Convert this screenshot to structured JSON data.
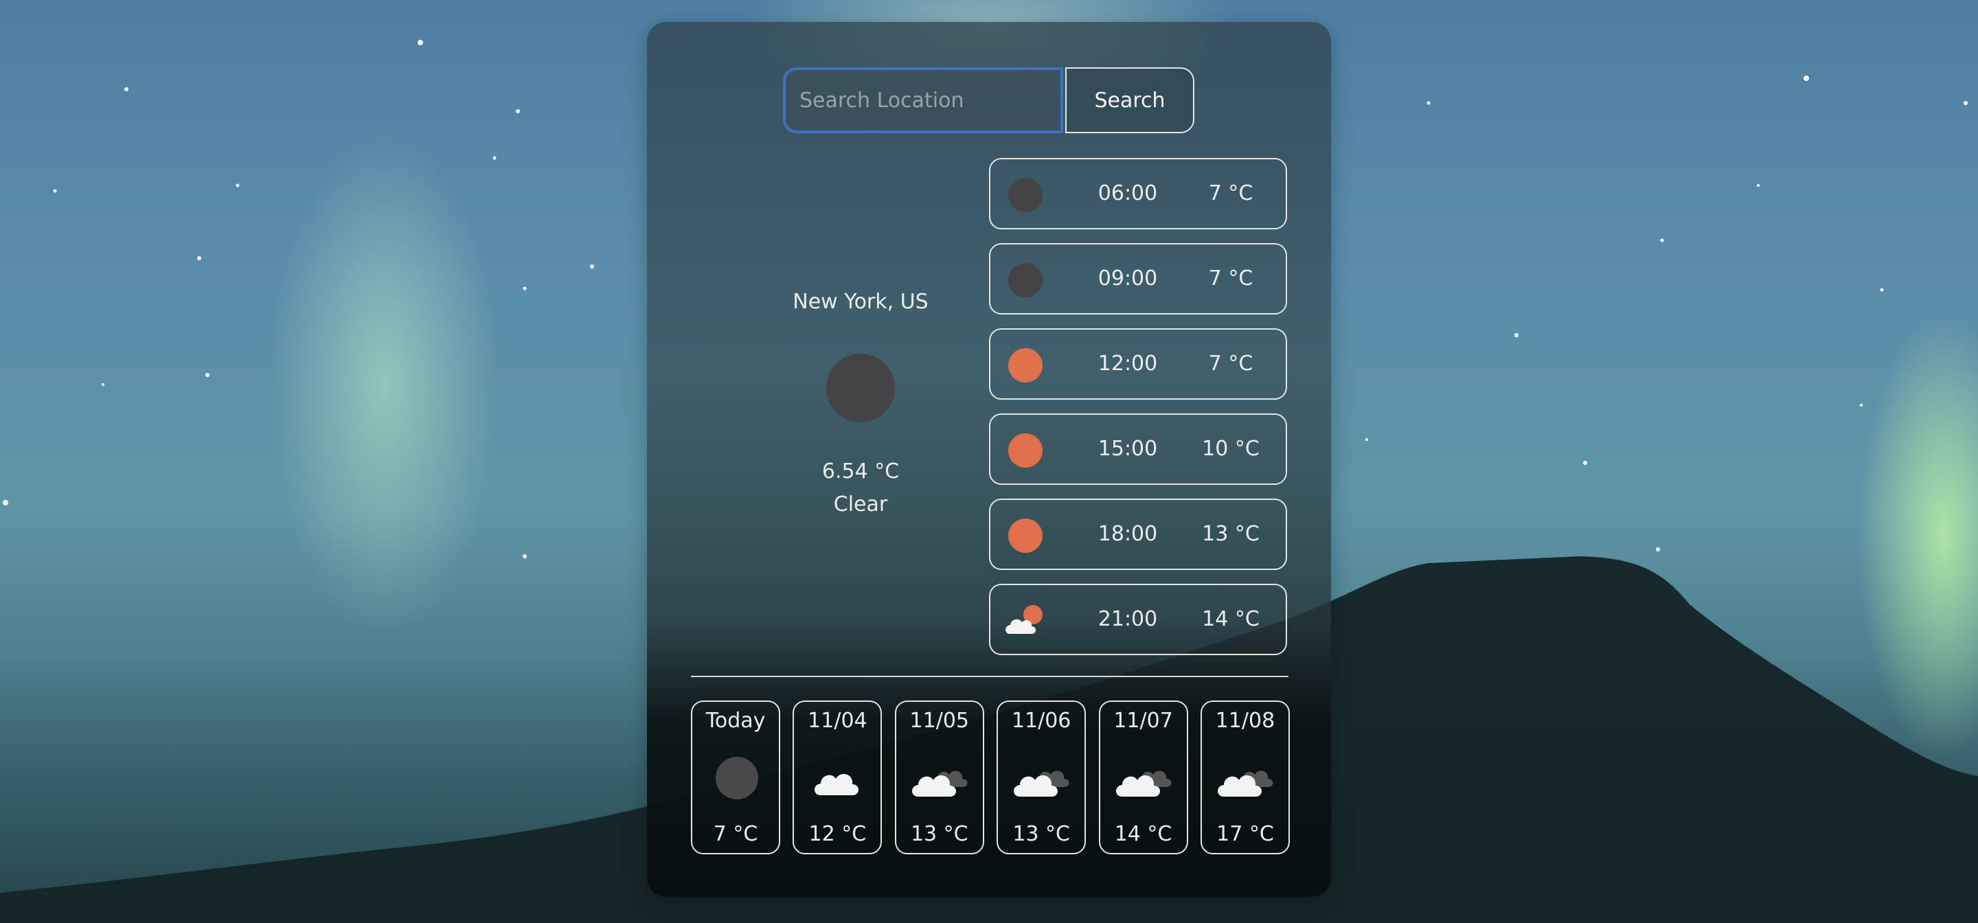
{
  "search": {
    "placeholder": "Search Location",
    "value": "",
    "button_label": "Search"
  },
  "current": {
    "location": "New York, US",
    "icon": "night-clear-icon",
    "temperature": "6.54 °C",
    "description": "Clear"
  },
  "hourly": [
    {
      "time": "06:00",
      "temp": "7 °C",
      "icon": "night-clear-icon"
    },
    {
      "time": "09:00",
      "temp": "7 °C",
      "icon": "night-clear-icon"
    },
    {
      "time": "12:00",
      "temp": "7 °C",
      "icon": "sun-icon"
    },
    {
      "time": "15:00",
      "temp": "10 °C",
      "icon": "sun-icon"
    },
    {
      "time": "18:00",
      "temp": "13 °C",
      "icon": "sun-icon"
    },
    {
      "time": "21:00",
      "temp": "14 °C",
      "icon": "partly-cloudy-icon"
    }
  ],
  "daily": [
    {
      "label": "Today",
      "temp": "7 °C",
      "icon": "night-clear-icon"
    },
    {
      "label": "11/04",
      "temp": "12 °C",
      "icon": "cloud-icon"
    },
    {
      "label": "11/05",
      "temp": "13 °C",
      "icon": "broken-clouds-icon"
    },
    {
      "label": "11/06",
      "temp": "13 °C",
      "icon": "broken-clouds-icon"
    },
    {
      "label": "11/07",
      "temp": "14 °C",
      "icon": "broken-clouds-icon"
    },
    {
      "label": "11/08",
      "temp": "17 °C",
      "icon": "broken-clouds-icon"
    }
  ],
  "colors": {
    "input_focus_border": "#3f6fc7",
    "sun": "#e0704c",
    "night": "#444446",
    "cloud": "#f4f4f4",
    "cloud_shadow": "#555555"
  }
}
